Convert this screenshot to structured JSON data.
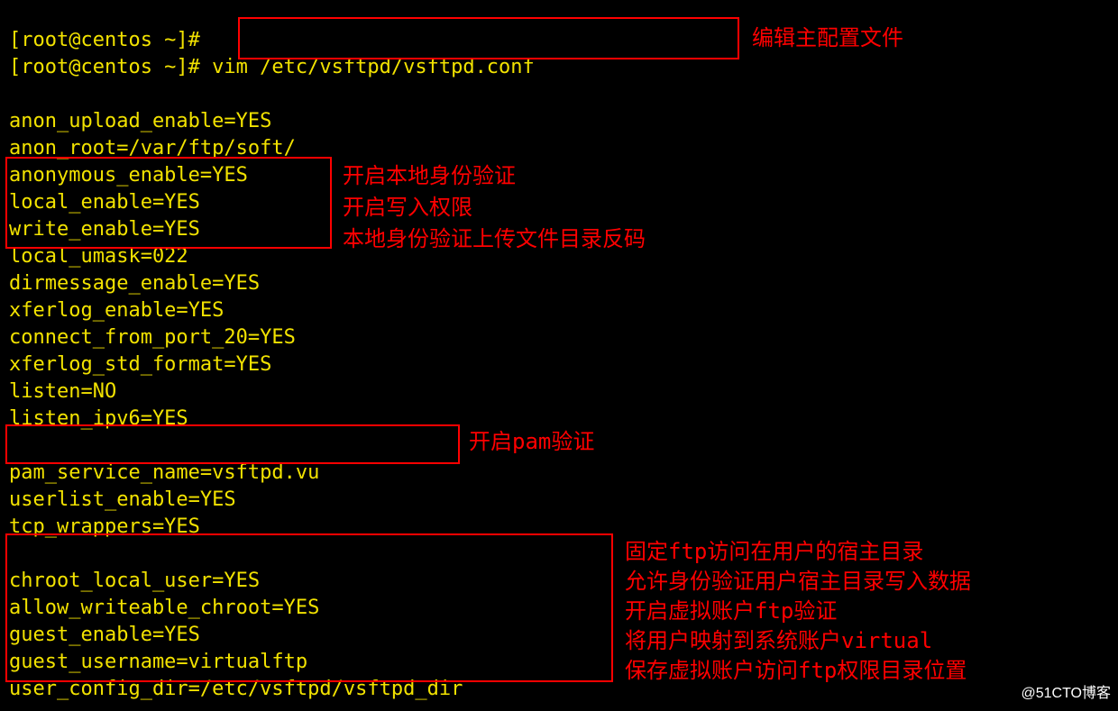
{
  "prompts": {
    "line0": "[root@centos ~]#",
    "line1_prefix": "[root@centos ~]# ",
    "line1_cmd": "vim /etc/vsftpd/vsftpd.conf"
  },
  "config": {
    "l1": "anon_upload_enable=YES",
    "l2": "anon_root=/var/ftp/soft/",
    "l3": "anonymous_enable=YES",
    "l4": "local_enable=YES",
    "l5": "write_enable=YES",
    "l6": "local_umask=022",
    "l7": "dirmessage_enable=YES",
    "l8": "xferlog_enable=YES",
    "l9": "connect_from_port_20=YES",
    "l10": "xferlog_std_format=YES",
    "l11": "listen=NO",
    "l12": "listen_ipv6=YES",
    "l13": "pam_service_name=vsftpd.vu",
    "l14": "userlist_enable=YES",
    "l15": "tcp_wrappers=YES",
    "l16": "chroot_local_user=YES",
    "l17": "allow_writeable_chroot=YES",
    "l18": "guest_enable=YES",
    "l19": "guest_username=virtualftp",
    "l20": "user_config_dir=/etc/vsftpd/vsftpd_dir"
  },
  "annotations": {
    "edit_main_conf": "编辑主配置文件",
    "local_enable": "开启本地身份验证",
    "write_enable": "开启写入权限",
    "local_umask": "本地身份验证上传文件目录反码",
    "pam": "开启pam验证",
    "chroot_local": "固定ftp访问在用户的宿主目录",
    "allow_write": "允许身份验证用户宿主目录写入数据",
    "guest_enable": "开启虚拟账户ftp验证",
    "guest_user": "将用户映射到系统账户virtual",
    "user_config": "保存虚拟账户访问ftp权限目录位置"
  },
  "watermark": "@51CTO博客"
}
